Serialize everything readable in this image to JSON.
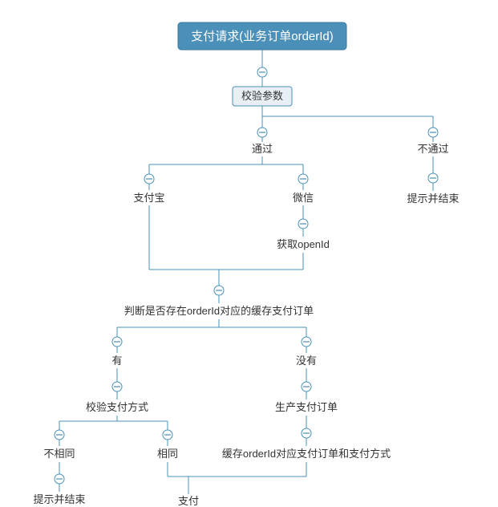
{
  "nodes": {
    "root": "支付请求(业务订单orderId)",
    "validate": "校验参数",
    "pass": "通过",
    "fail": "不通过",
    "fail_end": "提示并结束",
    "alipay": "支付宝",
    "wechat": "微信",
    "openid": "获取openId",
    "check_cache": "判断是否存在orderId对应的缓存支付订单",
    "has": "有",
    "none": "没有",
    "validate_method": "校验支付方式",
    "gen_order": "生产支付订单",
    "diff": "不相同",
    "same": "相同",
    "cache_store": "缓存orderId对应支付订单和支付方式",
    "diff_end": "提示并结束",
    "pay": "支付"
  }
}
